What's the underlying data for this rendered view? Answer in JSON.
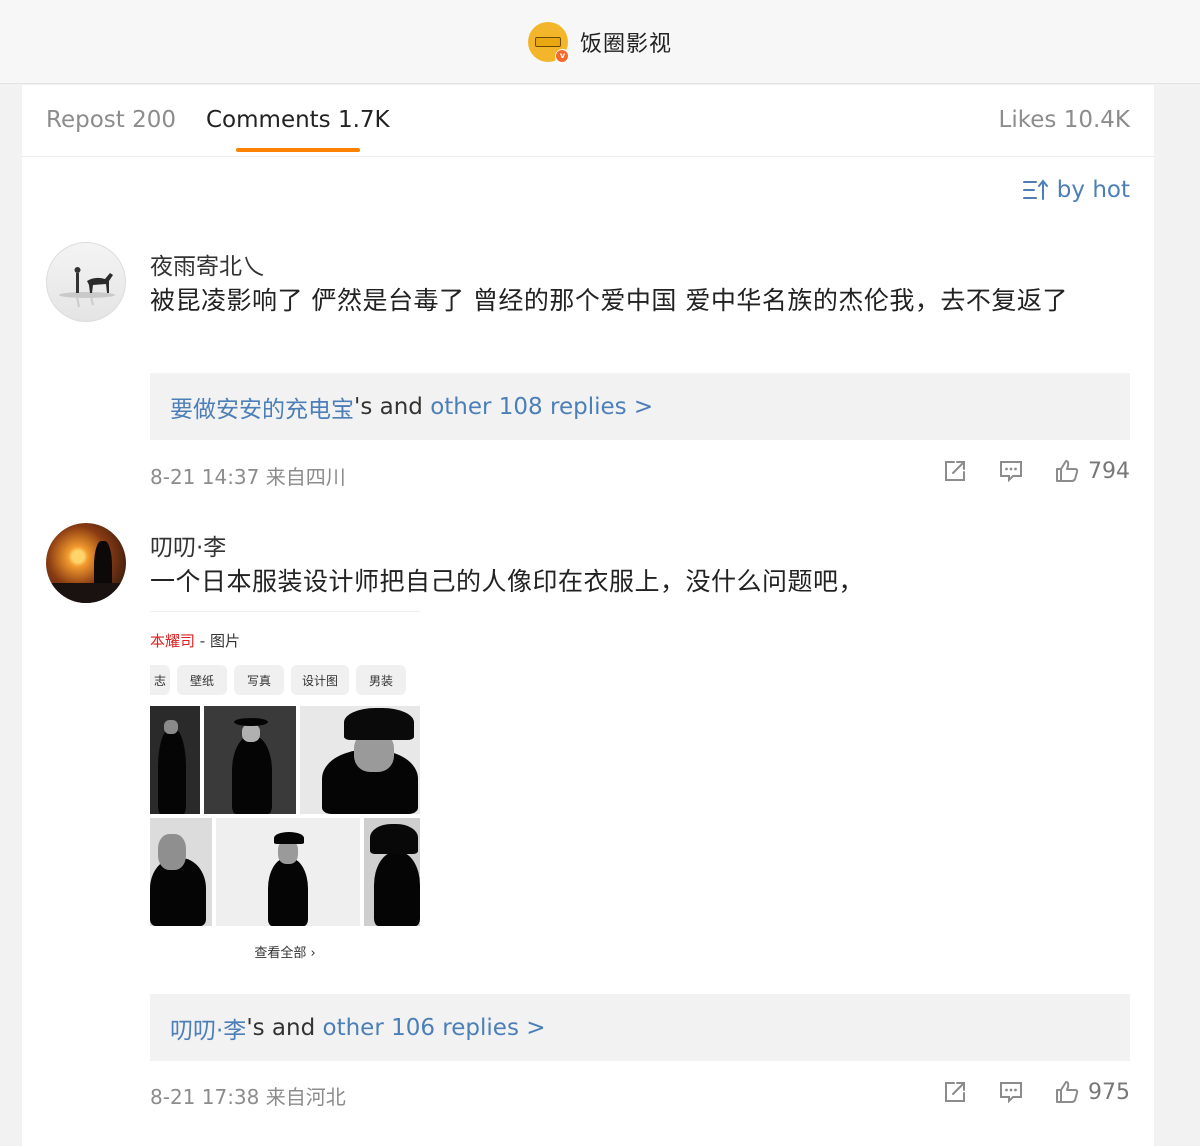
{
  "header": {
    "account_name": "饭圈影视"
  },
  "tabs": {
    "repost": "Repost 200",
    "comments": "Comments 1.7K",
    "likes": "Likes 10.4K"
  },
  "sort": {
    "label": "by hot"
  },
  "comments": [
    {
      "username": "夜雨寄北乀",
      "text": "被昆凌影响了 俨然是台毒了 曾经的那个爱中国 爱中华名族的杰伦我，去不复返了",
      "reply_author": "要做安安的充电宝",
      "reply_mid": "'s and ",
      "reply_more": "other 108 replies >",
      "meta": "8-21 14:37 来自四川",
      "likes": "794"
    },
    {
      "username": "叨叨·李",
      "text": "一个日本服装设计师把自己的人像印在衣服上，没什么问题吧，",
      "embed": {
        "title_red": "本耀司",
        "title_rest": " - 图片",
        "chips": [
          "志",
          "壁纸",
          "写真",
          "设计图",
          "男装"
        ],
        "view_all": "查看全部 ›"
      },
      "reply_author": "叨叨·李",
      "reply_mid": "'s and ",
      "reply_more": "other 106 replies >",
      "meta": "8-21 17:38 来自河北",
      "likes": "975"
    }
  ],
  "colors": {
    "accent": "#ff8200",
    "link": "#4c7fb8",
    "muted": "#8c8c8c"
  }
}
